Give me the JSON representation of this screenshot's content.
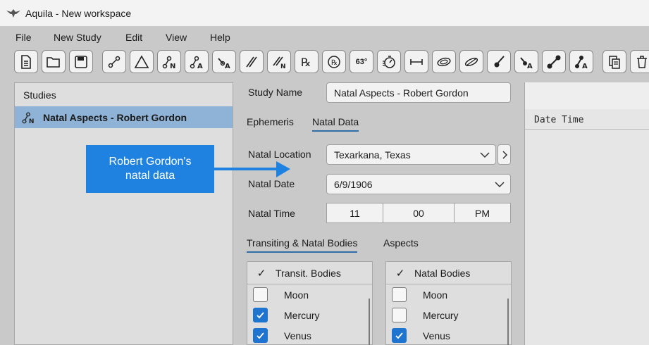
{
  "window": {
    "title": "Aquila - New workspace"
  },
  "menu": [
    "File",
    "New Study",
    "Edit",
    "View",
    "Help"
  ],
  "toolbar": {
    "icons": [
      "new-file-icon",
      "open-folder-icon",
      "save-icon",
      "line-aspect-icon",
      "triangle-icon",
      "natal-aspect-icon",
      "aspect-a-icon",
      "aspect-a-alt-icon",
      "parallel-icon",
      "parallel-n-icon",
      "rx-icon",
      "r-circle-icon",
      "degree-63-icon",
      "timer-icon",
      "span-icon",
      "ring-icon",
      "ring-tilt-icon",
      "slash-point-icon",
      "slash-a-icon",
      "dots-link-icon",
      "dots-a-icon",
      "copy-icon",
      "trash-icon"
    ],
    "degree_label": "63°"
  },
  "studies": {
    "header": "Studies",
    "items": [
      {
        "label": "Natal Aspects - Robert Gordon"
      }
    ]
  },
  "form": {
    "study_name_label": "Study Name",
    "study_name_value": "Natal Aspects - Robert Gordon",
    "tabs": [
      "Ephemeris",
      "Natal Data"
    ],
    "natal_location_label": "Natal Location",
    "natal_location_value": "Texarkana, Texas",
    "natal_date_label": "Natal Date",
    "natal_date_value": "6/9/1906",
    "natal_time_label": "Natal Time",
    "natal_time": {
      "hour": "11",
      "minute": "00",
      "ampm": "PM"
    },
    "body_tabs": [
      "Transiting & Natal Bodies",
      "Aspects"
    ]
  },
  "transit_panel": {
    "header_check": "✓",
    "header": "Transit. Bodies",
    "rows": [
      {
        "label": "Moon",
        "checked": false
      },
      {
        "label": "Mercury",
        "checked": true
      },
      {
        "label": "Venus",
        "checked": true
      }
    ]
  },
  "natal_panel": {
    "header_check": "✓",
    "header": "Natal Bodies",
    "rows": [
      {
        "label": "Moon",
        "checked": false
      },
      {
        "label": "Mercury",
        "checked": false
      },
      {
        "label": "Venus",
        "checked": true
      }
    ]
  },
  "right_panel": {
    "column_header": "Date Time"
  },
  "callout": {
    "line1": "Robert Gordon's",
    "line2": "natal data"
  },
  "colors": {
    "accent": "#2f6ea8",
    "selection": "#8fb3d6",
    "callout": "#1f82e0",
    "checkbox_on": "#1f74d0"
  }
}
